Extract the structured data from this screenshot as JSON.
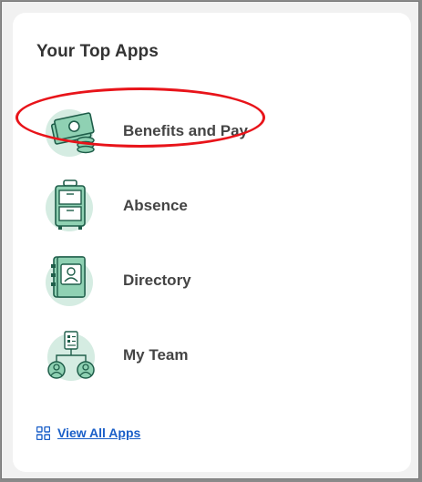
{
  "card": {
    "title": "Your Top Apps"
  },
  "apps": [
    {
      "label": "Benefits and Pay",
      "icon": "money-stack-icon"
    },
    {
      "label": "Absence",
      "icon": "suitcase-icon"
    },
    {
      "label": "Directory",
      "icon": "contact-book-icon"
    },
    {
      "label": "My Team",
      "icon": "team-org-icon"
    }
  ],
  "view_all": {
    "label": "View All Apps",
    "icon": "grid-icon"
  },
  "colors": {
    "accent_green": "#2f8f6e",
    "icon_bg": "#d5ece2",
    "link_blue": "#1a5fc8",
    "highlight_red": "#e8141a"
  }
}
